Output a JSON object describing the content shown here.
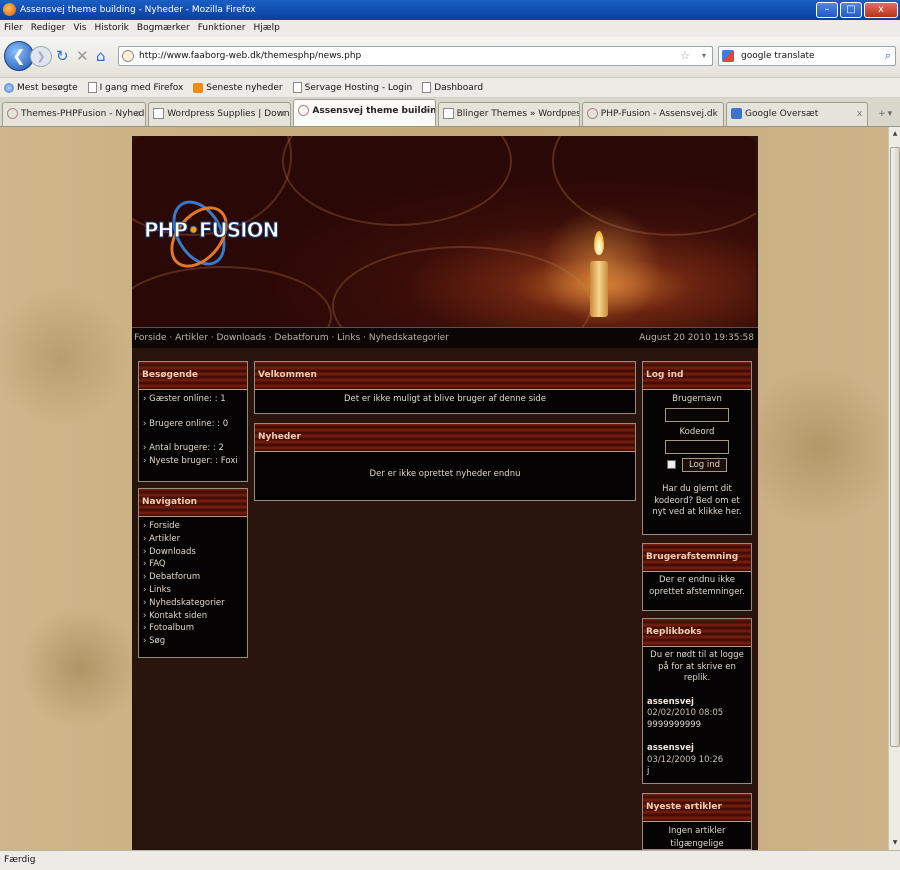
{
  "window": {
    "title": "Assensvej theme building - Nyheder - Mozilla Firefox",
    "min": "–",
    "max": "□",
    "close": "x"
  },
  "menu": [
    "Filer",
    "Rediger",
    "Vis",
    "Historik",
    "Bogmærker",
    "Funktioner",
    "Hjælp"
  ],
  "nav": {
    "url": "http://www.faaborg-web.dk/themesphp/news.php",
    "search": "google translate"
  },
  "bookmarks": [
    "Mest besøgte",
    "I gang med Firefox",
    "Seneste nyheder",
    "Servage Hosting - Login",
    "Dashboard"
  ],
  "tabs": [
    {
      "label": "Themes-PHPFusion - Nyheder"
    },
    {
      "label": "Wordpress Supplies | Download ..."
    },
    {
      "label": "Assensvej theme building - Ny..."
    },
    {
      "label": "Blinger Themes » Wordpress Th..."
    },
    {
      "label": "PHP-Fusion - Assensvej.dk"
    },
    {
      "label": "Google Oversæt"
    }
  ],
  "site": {
    "logo_left": "PHP",
    "logo_right": "FUSION",
    "sublinks": "Forside · Artikler · Downloads · Debatforum · Links · Nyhedskategorier",
    "date": "August 20 2010 19:35:58"
  },
  "visitors": {
    "title": "Besøgende",
    "guests": "Gæster online: : 1",
    "members": "Brugere online: : 0",
    "total": "Antal brugere: : 2",
    "newest": "Nyeste bruger: : Foxi"
  },
  "navigation": {
    "title": "Navigation",
    "items": [
      "Forside",
      "Artikler",
      "Downloads",
      "FAQ",
      "Debatforum",
      "Links",
      "Nyhedskategorier",
      "Kontakt siden",
      "Fotoalbum",
      "Søg"
    ]
  },
  "welcome": {
    "title": "Velkommen",
    "text": "Det er ikke muligt at blive bruger af denne side"
  },
  "news": {
    "title": "Nyheder",
    "text": "Der er ikke oprettet nyheder endnu"
  },
  "login": {
    "title": "Log ind",
    "username_label": "Brugernavn",
    "password_label": "Kodeord",
    "button": "Log ind",
    "forgot": "Har du glemt dit kodeord? Bed om et nyt ved at klikke her."
  },
  "poll": {
    "title": "Brugerafstemning",
    "text": "Der er endnu ikke oprettet afstemninger."
  },
  "shoutbox": {
    "title": "Replikboks",
    "notice": "Du er nødt til at logge på for at skrive en replik.",
    "entries": [
      {
        "user": "assensvej",
        "time": "02/02/2010 08:05",
        "msg": "9999999999"
      },
      {
        "user": "assensvej",
        "time": "03/12/2009 10:26",
        "msg": "j"
      }
    ]
  },
  "latest": {
    "title": "Nyeste artikler",
    "text": "Ingen artikler tilgængelige"
  },
  "status": "Færdig"
}
